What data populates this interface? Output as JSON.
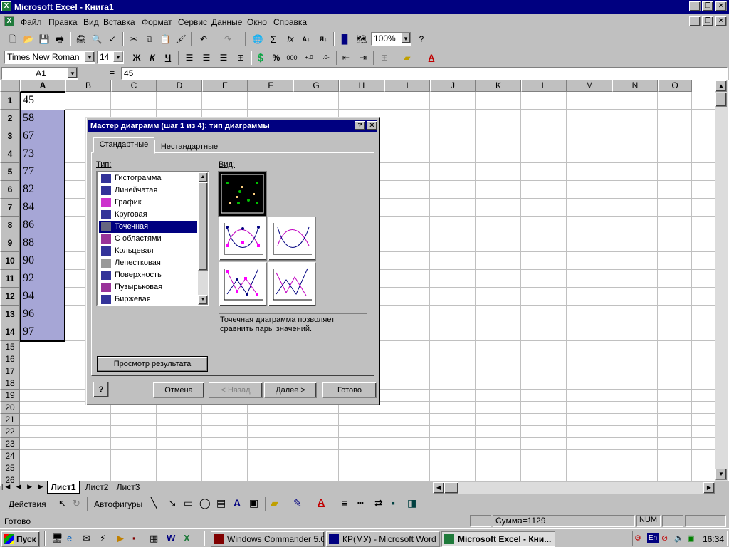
{
  "window": {
    "title": "Microsoft Excel - Книга1"
  },
  "menu": [
    "Файл",
    "Правка",
    "Вид",
    "Вставка",
    "Формат",
    "Сервис",
    "Данные",
    "Окно",
    "Справка"
  ],
  "toolbar": {
    "zoom": "100%",
    "font": "Times New Roman",
    "size": "14",
    "bold": "Ж",
    "italic": "К",
    "underline": "Ч",
    "percent": "%",
    "thousands": "000"
  },
  "formula": {
    "cellref": "A1",
    "eq": "=",
    "value": "45"
  },
  "columns": [
    "A",
    "B",
    "C",
    "D",
    "E",
    "F",
    "G",
    "H",
    "I",
    "J",
    "K",
    "L",
    "M",
    "N",
    "O"
  ],
  "rows": [
    "1",
    "2",
    "3",
    "4",
    "5",
    "6",
    "7",
    "8",
    "9",
    "10",
    "11",
    "12",
    "13",
    "14",
    "15",
    "16",
    "17",
    "18",
    "19",
    "20",
    "21",
    "22",
    "23",
    "24",
    "25",
    "26"
  ],
  "cells": [
    "45",
    "58",
    "67",
    "73",
    "77",
    "82",
    "84",
    "86",
    "88",
    "90",
    "92",
    "94",
    "96",
    "97"
  ],
  "dialog": {
    "title": "Мастер диаграмм (шаг 1 из 4): тип диаграммы",
    "tabs": [
      "Стандартные",
      "Нестандартные"
    ],
    "type_label": "Тип:",
    "view_label": "Вид:",
    "types": [
      "Гистограмма",
      "Линейчатая",
      "График",
      "Круговая",
      "Точечная",
      "С областями",
      "Кольцевая",
      "Лепестковая",
      "Поверхность",
      "Пузырьковая",
      "Биржевая"
    ],
    "selected_type": "Точечная",
    "description": "Точечная диаграмма позволяет сравнить пары значений.",
    "preview_button": "Просмотр результата",
    "buttons": {
      "cancel": "Отмена",
      "back": "< Назад",
      "next": "Далее >",
      "finish": "Готово"
    }
  },
  "sheets": [
    "Лист1",
    "Лист2",
    "Лист3"
  ],
  "drawing": {
    "actions": "Действия",
    "autoshapes": "Автофигуры"
  },
  "status": {
    "ready": "Готово",
    "sum": "Сумма=1129",
    "num": "NUM"
  },
  "taskbar": {
    "start": "Пуск",
    "tasks": [
      "Windows Commander 5.0 -...",
      "КР(МУ) - Microsoft Word",
      "Microsoft Excel - Кни..."
    ],
    "lang": "En",
    "clock": "16:34"
  },
  "colors": {
    "title_bg": "#000080",
    "selection": "#a6a6d6",
    "face": "#c0c0c0"
  }
}
